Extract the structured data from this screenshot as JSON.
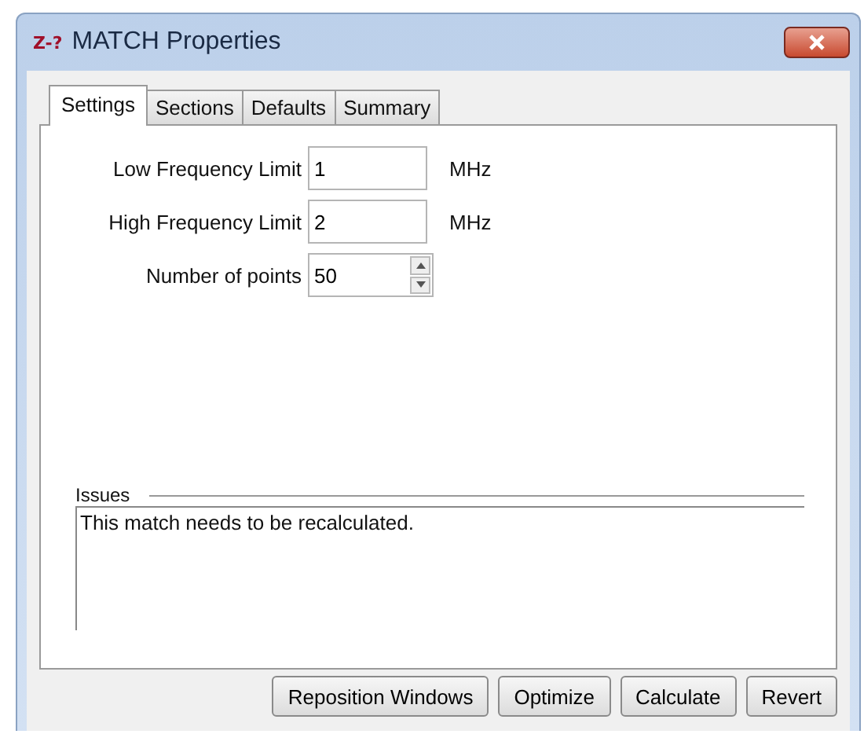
{
  "window": {
    "title": "MATCH Properties",
    "app_icon_text": "Z-?"
  },
  "tabs": [
    {
      "label": "Settings",
      "selected": true
    },
    {
      "label": "Sections",
      "selected": false
    },
    {
      "label": "Defaults",
      "selected": false
    },
    {
      "label": "Summary",
      "selected": false
    }
  ],
  "fields": [
    {
      "kind": "text",
      "label": "Low Frequency Limit",
      "value": "1",
      "unit": "MHz"
    },
    {
      "kind": "text",
      "label": "High Frequency Limit",
      "value": "2",
      "unit": "MHz"
    },
    {
      "kind": "spinner",
      "label": "Number of points",
      "value": "50"
    }
  ],
  "issues": {
    "title": "Issues",
    "text": "This match needs to be recalculated."
  },
  "buttons": [
    "Reposition Windows",
    "Optimize",
    "Calculate",
    "Revert"
  ]
}
